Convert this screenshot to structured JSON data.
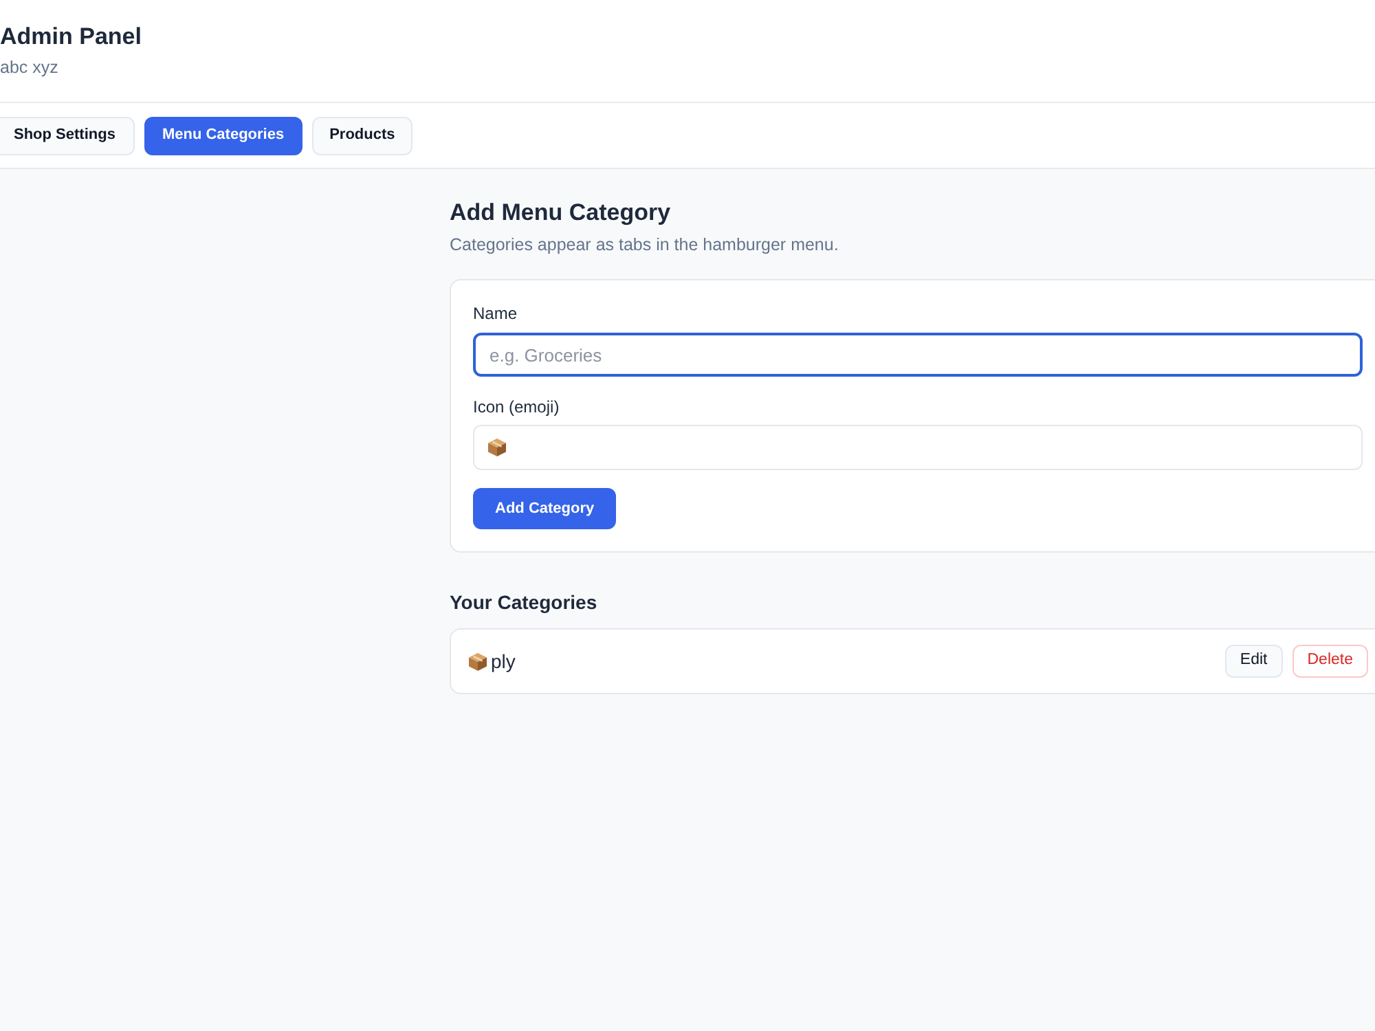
{
  "header": {
    "title": "Admin Panel",
    "subtitle": "abc xyz"
  },
  "tabs": [
    {
      "label": "Shop Settings",
      "selected": false
    },
    {
      "label": "Menu Categories",
      "selected": true
    },
    {
      "label": "Products",
      "selected": false
    }
  ],
  "form_section": {
    "title": "Add Menu Category",
    "description": "Categories appear as tabs in the hamburger menu.",
    "fields": [
      {
        "kind": "text",
        "label": "Name",
        "placeholder": "e.g. Groceries",
        "focused": true
      },
      {
        "kind": "emoji",
        "label": "Icon (emoji)",
        "focused": false
      }
    ],
    "submit": "Add Category"
  },
  "list_section": {
    "title": "Your Categories",
    "items": [
      {
        "name": "ply",
        "actions": [
          {
            "label": "Edit",
            "kind": "neutral"
          },
          {
            "label": "Delete",
            "kind": "danger"
          }
        ]
      }
    ]
  }
}
